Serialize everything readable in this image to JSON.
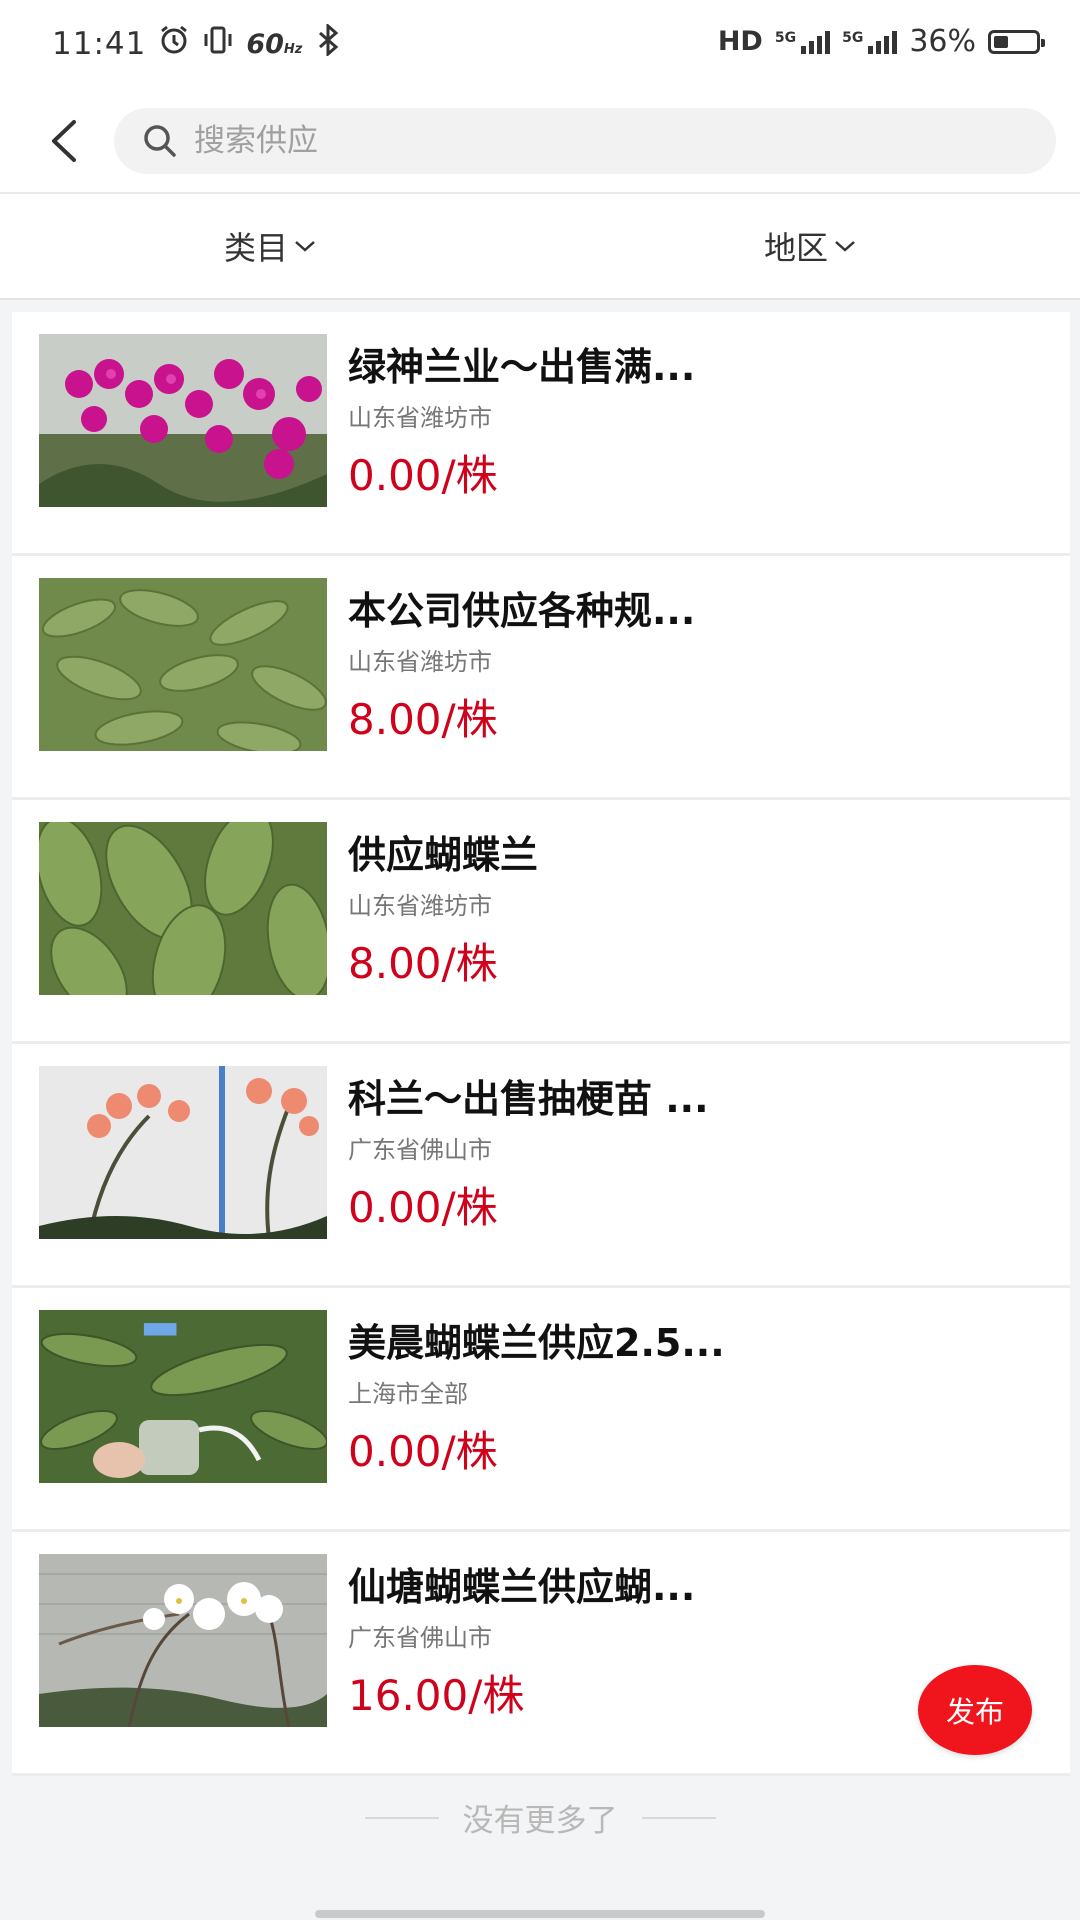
{
  "status_bar": {
    "time": "11:41",
    "refresh_rate": "60",
    "refresh_unit": "Hz",
    "network": "HD",
    "sim1_label": "5G",
    "sim2_label": "5G",
    "battery_percent": "36%",
    "battery_level": 0.36,
    "icons": [
      "alarm-icon",
      "vibrate-icon",
      "bluetooth-icon",
      "signal-icon",
      "battery-icon"
    ]
  },
  "search": {
    "placeholder": "搜索供应",
    "value": ""
  },
  "filters": [
    {
      "label": "类目",
      "icon": "chevron-down-icon"
    },
    {
      "label": "地区",
      "icon": "chevron-down-icon"
    }
  ],
  "items": [
    {
      "title": "绿神兰业～出售满...",
      "location": "山东省潍坊市",
      "price": "0.00/株",
      "image": "magenta-orchid-photo"
    },
    {
      "title": "本公司供应各种规...",
      "location": "山东省潍坊市",
      "price": "8.00/株",
      "image": "orchid-seedlings-photo"
    },
    {
      "title": "供应蝴蝶兰",
      "location": "山东省潍坊市",
      "price": "8.00/株",
      "image": "orchid-leaves-photo"
    },
    {
      "title": "科兰～出售抽梗苗 ...",
      "location": "广东省佛山市",
      "price": "0.00/株",
      "image": "peach-orchid-photo"
    },
    {
      "title": "美晨蝴蝶兰供应2.5...",
      "location": "上海市全部",
      "price": "0.00/株",
      "image": "orchid-in-hand-photo"
    },
    {
      "title": "仙塘蝴蝶兰供应蝴...",
      "location": "广东省佛山市",
      "price": "16.00/株",
      "image": "white-orchid-photo"
    }
  ],
  "footer": {
    "no_more": "没有更多了"
  },
  "fab": {
    "label": "发布"
  },
  "colors": {
    "price": "#d0021b",
    "fab": "#f0141c",
    "background": "#f3f4f6"
  }
}
